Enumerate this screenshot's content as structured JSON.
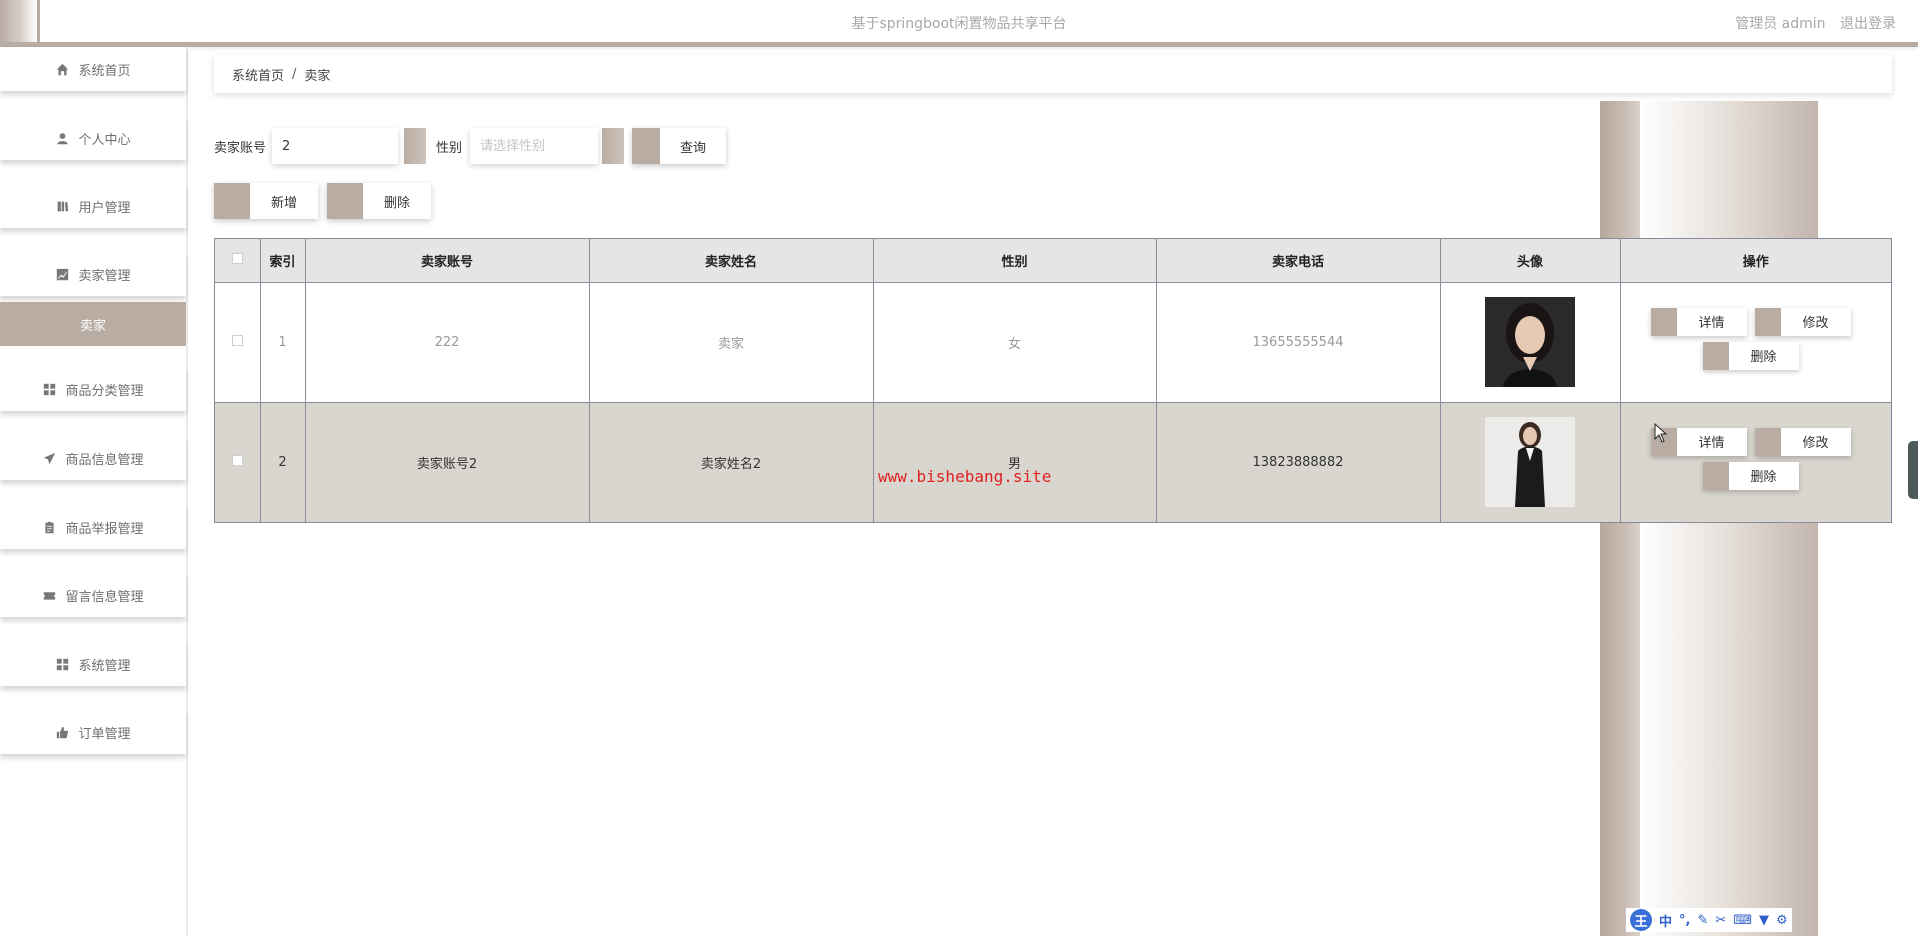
{
  "header": {
    "title": "基于springboot闲置物品共享平台",
    "user_role": "管理员 admin",
    "logout_label": "退出登录"
  },
  "sidebar": {
    "items": [
      {
        "label": "系统首页",
        "icon": "home-icon"
      },
      {
        "label": "个人中心",
        "icon": "user-icon"
      },
      {
        "label": "用户管理",
        "icon": "book-icon"
      },
      {
        "label": "卖家管理",
        "icon": "chart-icon"
      },
      {
        "label": "卖家",
        "icon": ""
      },
      {
        "label": "商品分类管理",
        "icon": "grid-icon"
      },
      {
        "label": "商品信息管理",
        "icon": "send-icon"
      },
      {
        "label": "商品举报管理",
        "icon": "clipboard-icon"
      },
      {
        "label": "留言信息管理",
        "icon": "ticket-icon"
      },
      {
        "label": "系统管理",
        "icon": "grid-icon"
      },
      {
        "label": "订单管理",
        "icon": "thumb-icon"
      }
    ]
  },
  "breadcrumb": {
    "home": "系统首页",
    "separator": "/",
    "current": "卖家"
  },
  "search": {
    "account_label": "卖家账号",
    "account_value": "2",
    "gender_label": "性别",
    "gender_placeholder": "请选择性别",
    "query_label": "查询"
  },
  "actions": {
    "add_label": "新增",
    "delete_label": "删除"
  },
  "table": {
    "columns": [
      "索引",
      "卖家账号",
      "卖家姓名",
      "性别",
      "卖家电话",
      "头像",
      "操作"
    ],
    "rows": [
      {
        "index": "1",
        "account": "222",
        "name": "卖家",
        "gender": "女",
        "phone": "13655555544",
        "avatar": "female-avatar"
      },
      {
        "index": "2",
        "account": "卖家账号2",
        "name": "卖家姓名2",
        "gender": "男",
        "phone": "13823888882",
        "avatar": "businesswoman-avatar"
      }
    ],
    "ops": {
      "detail": "详情",
      "edit": "修改",
      "delete": "删除"
    }
  },
  "watermark": "www.bishebang.site",
  "ime": {
    "logo": "王",
    "mode": "中"
  },
  "colors": {
    "accent": "#b8aca3",
    "row_highlight": "#d9d6cf",
    "header_bg": "#e5e5e5",
    "watermark": "#e02020"
  }
}
